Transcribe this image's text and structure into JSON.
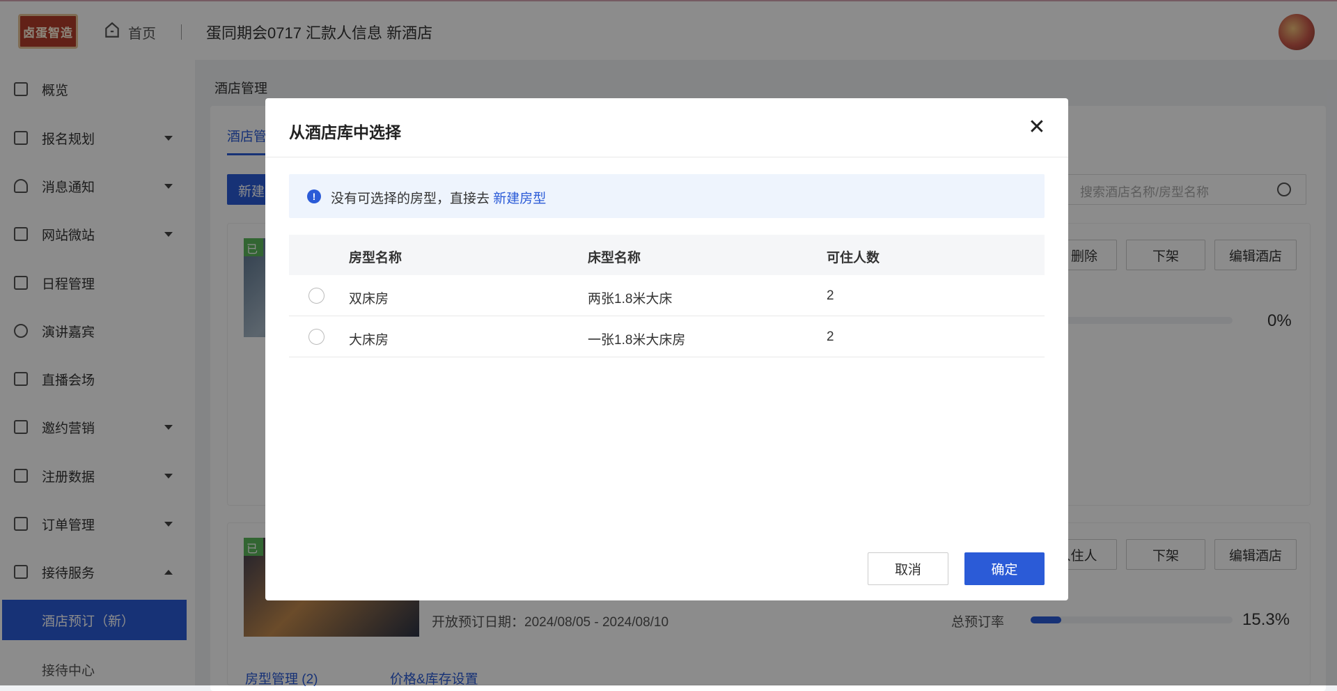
{
  "header": {
    "logo_text": "卤蛋智造",
    "home_label": "首页",
    "event_title": "蛋同期会0717 汇款人信息 新酒店"
  },
  "sidebar": {
    "items": [
      {
        "label": "概览"
      },
      {
        "label": "报名规划"
      },
      {
        "label": "消息通知"
      },
      {
        "label": "网站微站"
      },
      {
        "label": "日程管理"
      },
      {
        "label": "演讲嘉宾"
      },
      {
        "label": "直播会场"
      },
      {
        "label": "邀约营销"
      },
      {
        "label": "注册数据"
      },
      {
        "label": "订单管理"
      },
      {
        "label": "接待服务"
      }
    ],
    "active_sub": "酒店预订（新）",
    "next_sub": "接待中心"
  },
  "content": {
    "breadcrumb": "酒店管理",
    "tab_label": "酒店管",
    "new_button": "新建",
    "search_placeholder": "搜索酒店名称/房型名称",
    "hotel1": {
      "tag": "已",
      "buttons": [
        "删除",
        "下架",
        "编辑酒店"
      ],
      "percent": "0%",
      "rate_value": 0
    },
    "hotel2": {
      "tag": "已",
      "buttons": [
        "入住人",
        "下架",
        "编辑酒店"
      ],
      "open_dates": "开放预订日期：2024/08/05 - 2024/08/10",
      "rate_label": "总预订率",
      "percent": "15.3%",
      "rate_value": 0.153,
      "room_mgmt": "房型管理 (2)",
      "price_stock": "价格&库存设置"
    }
  },
  "modal": {
    "title": "从酒店库中选择",
    "alert_text": "没有可选择的房型，直接去",
    "alert_link": "新建房型",
    "columns": [
      "房型名称",
      "床型名称",
      "可住人数"
    ],
    "rows": [
      {
        "room": "双床房",
        "bed": "两张1.8米大床",
        "capacity": "2"
      },
      {
        "room": "大床房",
        "bed": "一张1.8米大床房",
        "capacity": "2"
      }
    ],
    "cancel_label": "取消",
    "confirm_label": "确定"
  }
}
